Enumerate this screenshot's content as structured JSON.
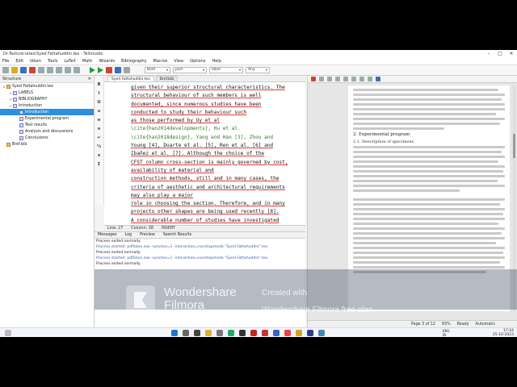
{
  "window": {
    "title": "Dr.Texture-latex\\Syed Fattahuddin.tex - TeXstudio"
  },
  "menu": [
    "File",
    "Edit",
    "Idiom",
    "Tools",
    "LaTeX",
    "Math",
    "Wizards",
    "Bibliography",
    "Macros",
    "View",
    "Options",
    "Help"
  ],
  "toolbar": {
    "combo1": "Bold",
    "combo2": "part",
    "combo3": "label",
    "combo4": "Any"
  },
  "structure": {
    "title": "Structure",
    "items": [
      {
        "label": "Syed Fattahuddin.tex",
        "level": 0,
        "expander": "v"
      },
      {
        "label": "LABELS",
        "level": 1,
        "expander": ">"
      },
      {
        "label": "BIBLIOGRAPHY",
        "level": 1,
        "expander": ">"
      },
      {
        "label": "Introduction",
        "level": 1,
        "expander": "v"
      },
      {
        "label": "Introduction",
        "level": 2,
        "expander": "",
        "selected": true
      },
      {
        "label": "Experimental program",
        "level": 2,
        "expander": ""
      },
      {
        "label": "Test results",
        "level": 2,
        "expander": ""
      },
      {
        "label": "Analysis and discussions",
        "level": 2,
        "expander": ""
      },
      {
        "label": "Conclusions",
        "level": 2,
        "expander": ""
      },
      {
        "label": "Bref.bib",
        "level": 0,
        "expander": ""
      }
    ]
  },
  "editor": {
    "tabs": [
      "Syed Fattahuddin.tex",
      "Bref.bib"
    ],
    "lines": [
      "given their superior structural characteristics. The",
      "structural behaviour of such members is well",
      "documented, since numerous studies have been",
      "conducted to study their behaviour such",
      "as those performed by Uy et al",
      "\\cite{han2014developments}, Hu et al.",
      "\\cite{han2018design}, Yang and Han [3], Zhou and",
      "Young [4], Duarte et al. [5], Ren et al. [6] and",
      "Ibañez et al. [7]. Although the choice of the",
      "CFST column cross-section is mainly governed by cost,",
      "availability of material and",
      "construction methods, still and in many cases, the",
      "criteria of aesthetic and architectural requirements",
      "may also play a major",
      "role in choosing the section. Therefore, and in many",
      "projects other shapes are being used recently [8].",
      "",
      "A considerable number of studies have investigated"
    ],
    "status": {
      "line": "Line: 27",
      "column": "Column: 38",
      "mode": "INSERT"
    }
  },
  "messages": {
    "tabs": [
      "Messages",
      "Log",
      "Preview",
      "Search Results"
    ],
    "lines": [
      {
        "text": "Process exited normally",
        "color": "black"
      },
      {
        "text": "",
        "color": "black"
      },
      {
        "text": "",
        "color": "black"
      },
      {
        "text": "Process started: pdflatex.exe -synctex=1 -interaction=nonstopmode \"Syed Fattahuddin\".tex",
        "color": "blue"
      },
      {
        "text": "",
        "color": "black"
      },
      {
        "text": "Process exited normally",
        "color": "black"
      },
      {
        "text": "",
        "color": "black"
      },
      {
        "text": "",
        "color": "black"
      },
      {
        "text": "Process started: pdflatex.exe -synctex=1 -interaction=nonstopmode \"Syed Fattahuddin\".tex",
        "color": "blue"
      },
      {
        "text": "",
        "color": "black"
      },
      {
        "text": "Process exited normally",
        "color": "black"
      }
    ]
  },
  "pdf": {
    "heading": "2. Experimental program",
    "subheading": "2.1. Description of specimens",
    "page_indicator": "Page 3 of 12",
    "zoom": "83%",
    "status": "Ready",
    "mode": "Automatic"
  },
  "watermark": {
    "brand_line1": "Wondershare",
    "brand_line2": "Filmora",
    "made_line": "Created with",
    "free_line": "Wondershare Filmora free plan"
  },
  "taskbar": {
    "lang1": "ENG",
    "lang2": "IN",
    "time": "17:24",
    "date": "25-10-2023"
  },
  "colors": {
    "accent": "#2d8fe0",
    "selection": "#2d8fe0",
    "code_link": "#2a7a2a"
  }
}
